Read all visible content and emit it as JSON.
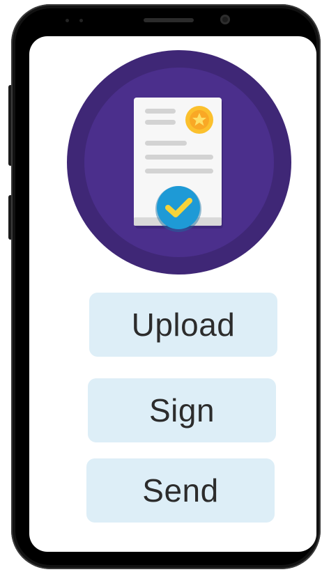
{
  "illustration": {
    "icon": "certified-document-icon",
    "badge_icon": "seal-star-icon",
    "check_icon": "checkmark-icon",
    "colors": {
      "outer_circle": "#3f2776",
      "inner_circle": "#4b2f8c",
      "paper": "#f7f7f7",
      "paper_lines": "#d3d3d3",
      "seal": "#fbc02d",
      "check_circle": "#1e9ad6",
      "check_mark": "#f6d33a"
    }
  },
  "actions": {
    "upload_label": "Upload",
    "sign_label": "Sign",
    "send_label": "Send"
  },
  "theme": {
    "button_bg": "#ddeef7",
    "button_text": "#2c2c2c",
    "phone_frame": "#121212"
  }
}
